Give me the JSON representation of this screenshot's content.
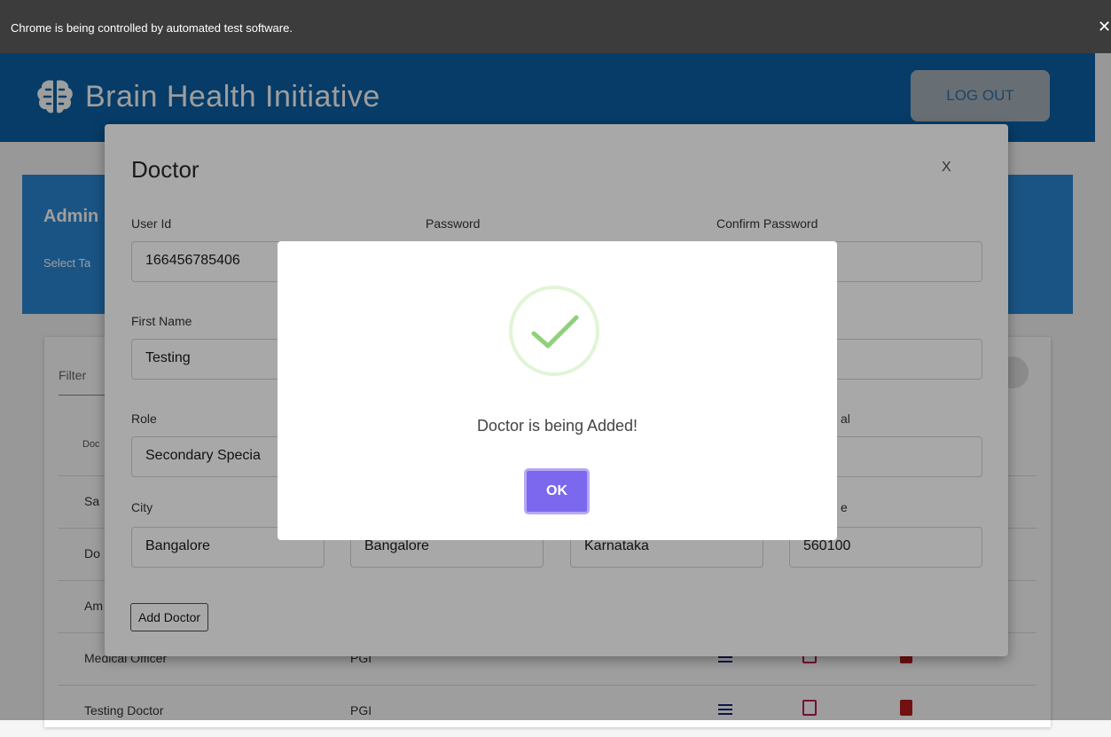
{
  "infobar": {
    "message": "Chrome is being controlled by automated test software.",
    "close": "✕"
  },
  "header": {
    "brand_title": "Brain Health Initiative",
    "logout_label": "LOG OUT"
  },
  "admin": {
    "title": "Admin",
    "subtitle": "Select Ta"
  },
  "list": {
    "filter_placeholder": "Filter",
    "column_header": "Doc",
    "rows": [
      {
        "name": "Sa",
        "place": ""
      },
      {
        "name": "Do",
        "place": ""
      },
      {
        "name": "Am",
        "place": ""
      },
      {
        "name": "Medical Officer",
        "place": "PGI"
      },
      {
        "name": "Testing Doctor",
        "place": "PGI"
      }
    ]
  },
  "doctor_modal": {
    "title": "Doctor",
    "close_label": "X",
    "labels": {
      "user_id": "User Id",
      "password": "Password",
      "confirm_password": "Confirm Password",
      "first_name": "First Name",
      "role": "Role",
      "role_right_partial": "al",
      "city": "City",
      "pincode_partial": "e"
    },
    "values": {
      "user_id": "166456785406",
      "first_name": "Testing",
      "role": "Secondary Specia",
      "city": "Bangalore",
      "district": "Bangalore",
      "state": "Karnataka",
      "pincode": "560100"
    },
    "add_button": "Add Doctor"
  },
  "alert": {
    "message": "Doctor is being Added!",
    "ok_label": "OK"
  },
  "colors": {
    "header": "#0a62a6",
    "admin_panel": "#2a88d6",
    "ok_button": "#7b68ee",
    "check": "#8fd17a"
  }
}
